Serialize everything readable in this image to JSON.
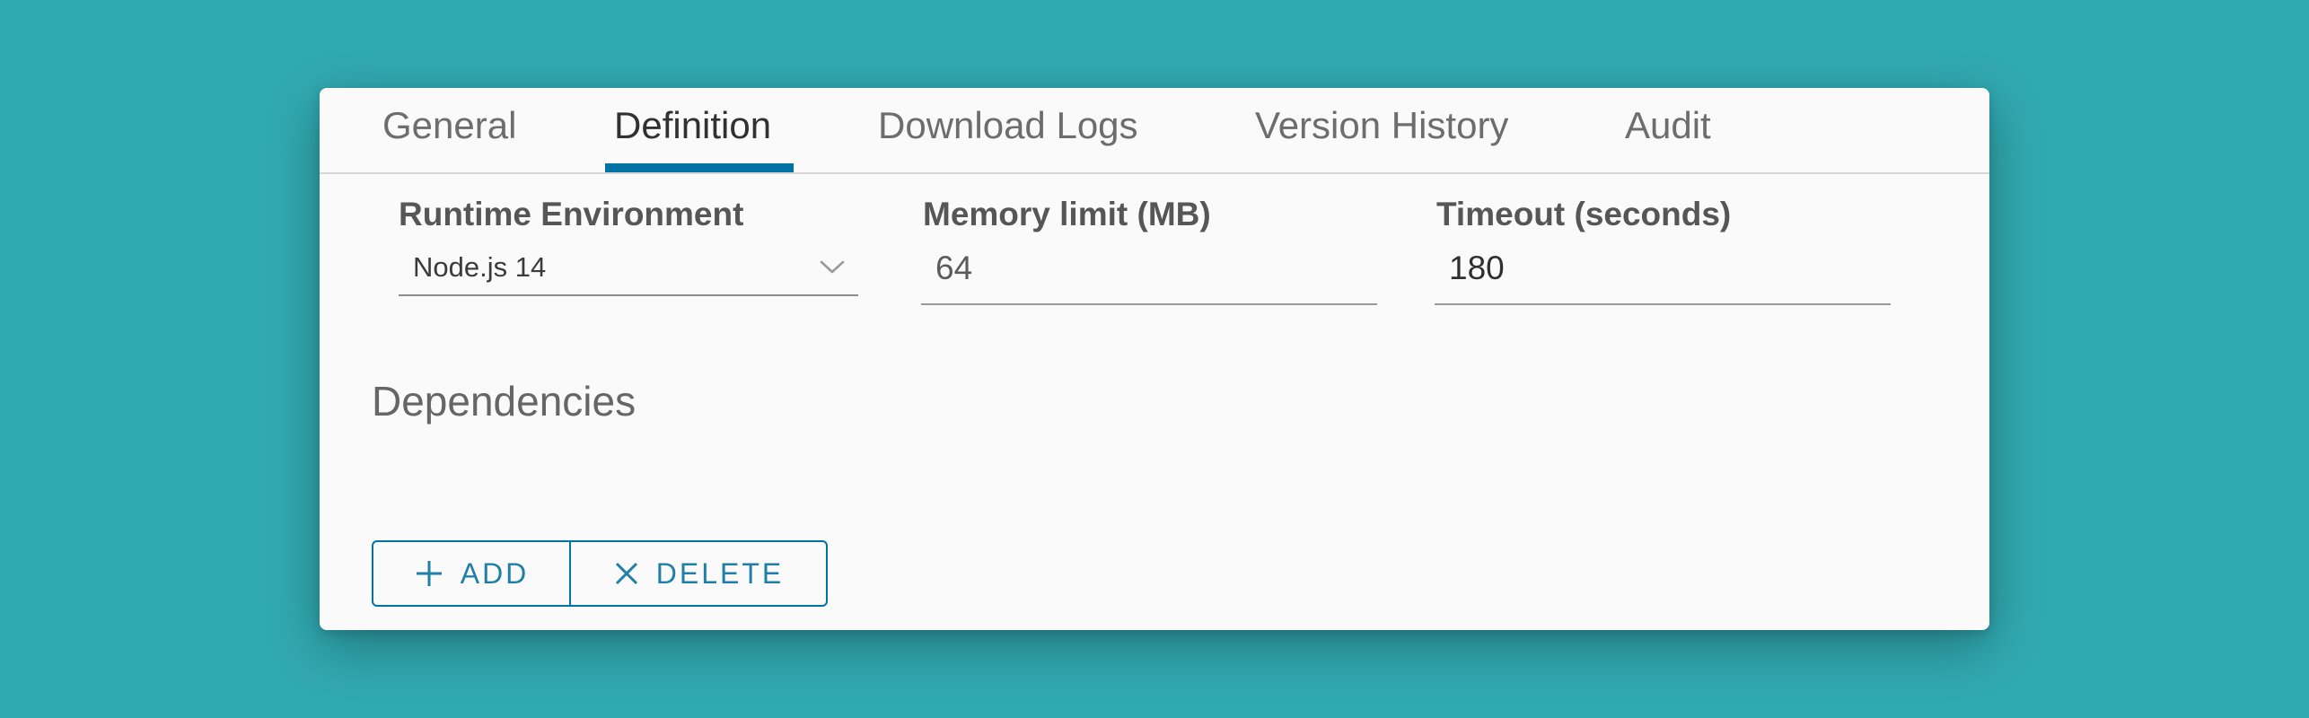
{
  "tabs": [
    {
      "label": "General",
      "active": false
    },
    {
      "label": "Definition",
      "active": true
    },
    {
      "label": "Download Logs",
      "active": false
    },
    {
      "label": "Version History",
      "active": false
    },
    {
      "label": "Audit",
      "active": false
    }
  ],
  "fields": {
    "runtime": {
      "label": "Runtime Environment",
      "value": "Node.js 14",
      "icon": "chevron-down-icon"
    },
    "memory": {
      "label": "Memory limit (MB)",
      "value": "64"
    },
    "timeout": {
      "label": "Timeout (seconds)",
      "value": "180"
    }
  },
  "dependencies": {
    "title": "Dependencies",
    "add_label": "ADD",
    "add_icon": "plus-icon",
    "delete_label": "DELETE",
    "delete_icon": "close-icon"
  },
  "colors": {
    "background": "#31a9b1",
    "accent": "#0072a3"
  }
}
